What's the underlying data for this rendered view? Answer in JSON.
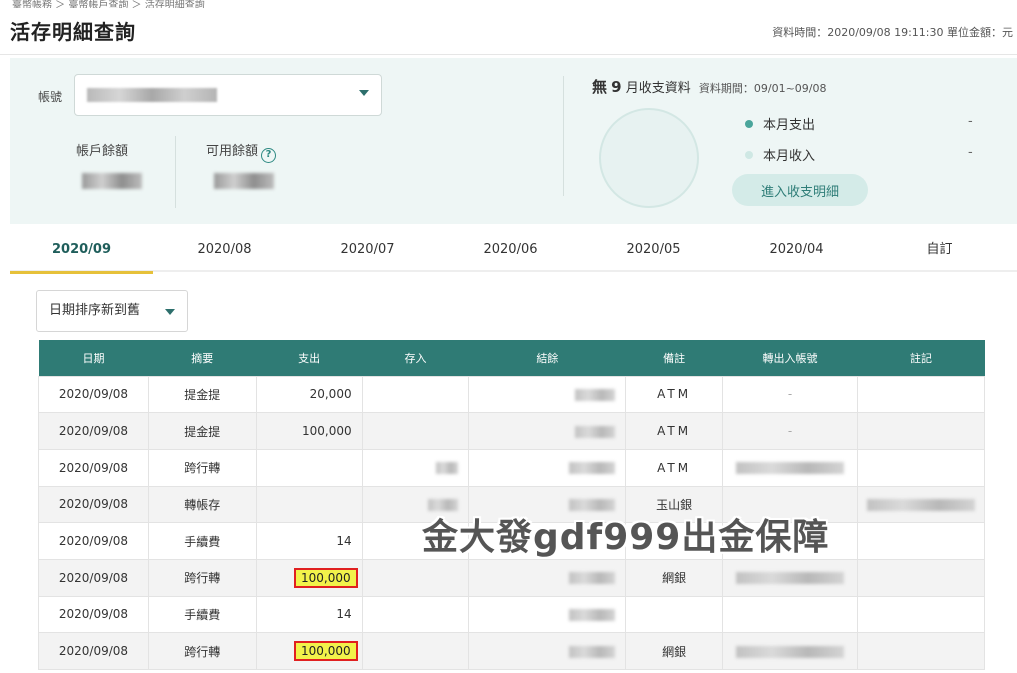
{
  "breadcrumb": "臺幣帳務 ＞ 臺幣帳戶查詢 ＞ 活存明細查詢",
  "page_title": "活存明細查詢",
  "data_time": "資料時間：2020/09/08 19:11:30 單位金額：元",
  "account": {
    "label": "帳號",
    "balance_label": "帳戶餘額",
    "available_label": "可用餘額",
    "help_icon": "question-circle-icon"
  },
  "stats": {
    "prefix": "無",
    "month": "9",
    "suffix": "月收支資料",
    "period": "資料期間：09/01~09/08",
    "expense_label": "本月支出",
    "expense_value": "-",
    "income_label": "本月收入",
    "income_value": "-",
    "detail_button": "進入收支明細",
    "expense_color": "#4aa59b",
    "income_color": "#cfe8e4"
  },
  "tabs": [
    "2020/09",
    "2020/08",
    "2020/07",
    "2020/06",
    "2020/05",
    "2020/04",
    "自訂"
  ],
  "sort": {
    "label": "日期排序新到舊"
  },
  "table": {
    "headers": [
      "日期",
      "摘要",
      "支出",
      "存入",
      "結餘",
      "備註",
      "轉出入帳號",
      "註記"
    ],
    "rows": [
      {
        "date": "2020/09/08",
        "summary": "提金提",
        "out": "20,000",
        "in": "",
        "note": "ATM",
        "account": "-",
        "highlight": false
      },
      {
        "date": "2020/09/08",
        "summary": "提金提",
        "out": "100,000",
        "in": "",
        "note": "ATM",
        "account": "-",
        "highlight": false
      },
      {
        "date": "2020/09/08",
        "summary": "跨行轉",
        "out": "",
        "in": "",
        "note": "ATM",
        "account": "",
        "highlight": false
      },
      {
        "date": "2020/09/08",
        "summary": "轉帳存",
        "out": "",
        "in": "",
        "note": "玉山銀",
        "account": "",
        "highlight": false
      },
      {
        "date": "2020/09/08",
        "summary": "手續費",
        "out": "14",
        "in": "",
        "note": "",
        "account": "",
        "highlight": false
      },
      {
        "date": "2020/09/08",
        "summary": "跨行轉",
        "out": "100,000",
        "in": "",
        "note": "網銀",
        "account": "",
        "highlight": true
      },
      {
        "date": "2020/09/08",
        "summary": "手續費",
        "out": "14",
        "in": "",
        "note": "",
        "account": "",
        "highlight": false
      },
      {
        "date": "2020/09/08",
        "summary": "跨行轉",
        "out": "100,000",
        "in": "",
        "note": "網銀",
        "account": "",
        "highlight": true
      }
    ]
  },
  "watermark": "金大發gdf999出金保障",
  "colors": {
    "header_bg": "#2f7b75",
    "summary_bg": "#eef6f5",
    "tab_underline": "#e6c13a",
    "highlight_border": "#e02020",
    "highlight_fill": "#f2f24a"
  }
}
